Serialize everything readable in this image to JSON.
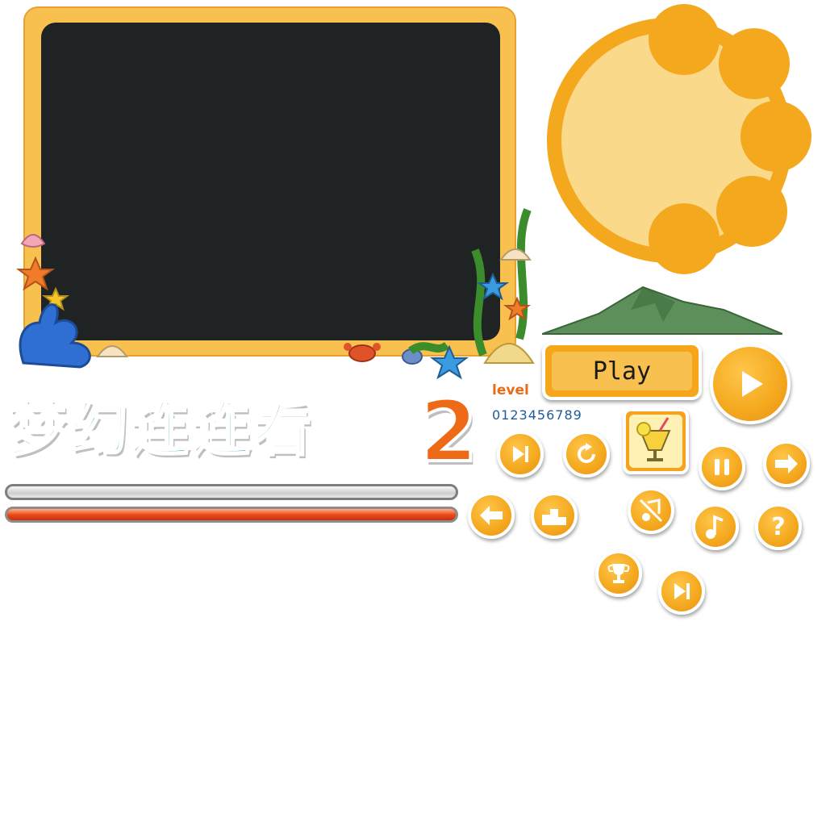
{
  "title": {
    "main": "梦幻连连看",
    "number": "2"
  },
  "play_button": {
    "label": "Play"
  },
  "level": {
    "label": "level",
    "digits": "0123456789"
  },
  "progress": {
    "empty_value": 0,
    "full_value": 1
  },
  "icons": [
    "ocean-board-frame",
    "sun-panel",
    "mountain-island",
    "play-triangle-icon",
    "skip-sound-icon",
    "restart-icon",
    "lemonade-icon",
    "pause-icon",
    "next-arrow-icon",
    "back-arrow-icon",
    "podium-icon",
    "music-off-icon",
    "music-note-icon",
    "help-icon",
    "trophy-icon",
    "fast-forward-icon"
  ],
  "colors": {
    "accent": "#f4a81d",
    "board_frame": "#f8c14f",
    "board_screen": "#1f2324",
    "title_text": "#3a9fb4",
    "title_number": "#ee6a17",
    "level_text": "#e86b18",
    "digits_text": "#1f5a9a",
    "progress_fill": "#ed4c1c"
  }
}
